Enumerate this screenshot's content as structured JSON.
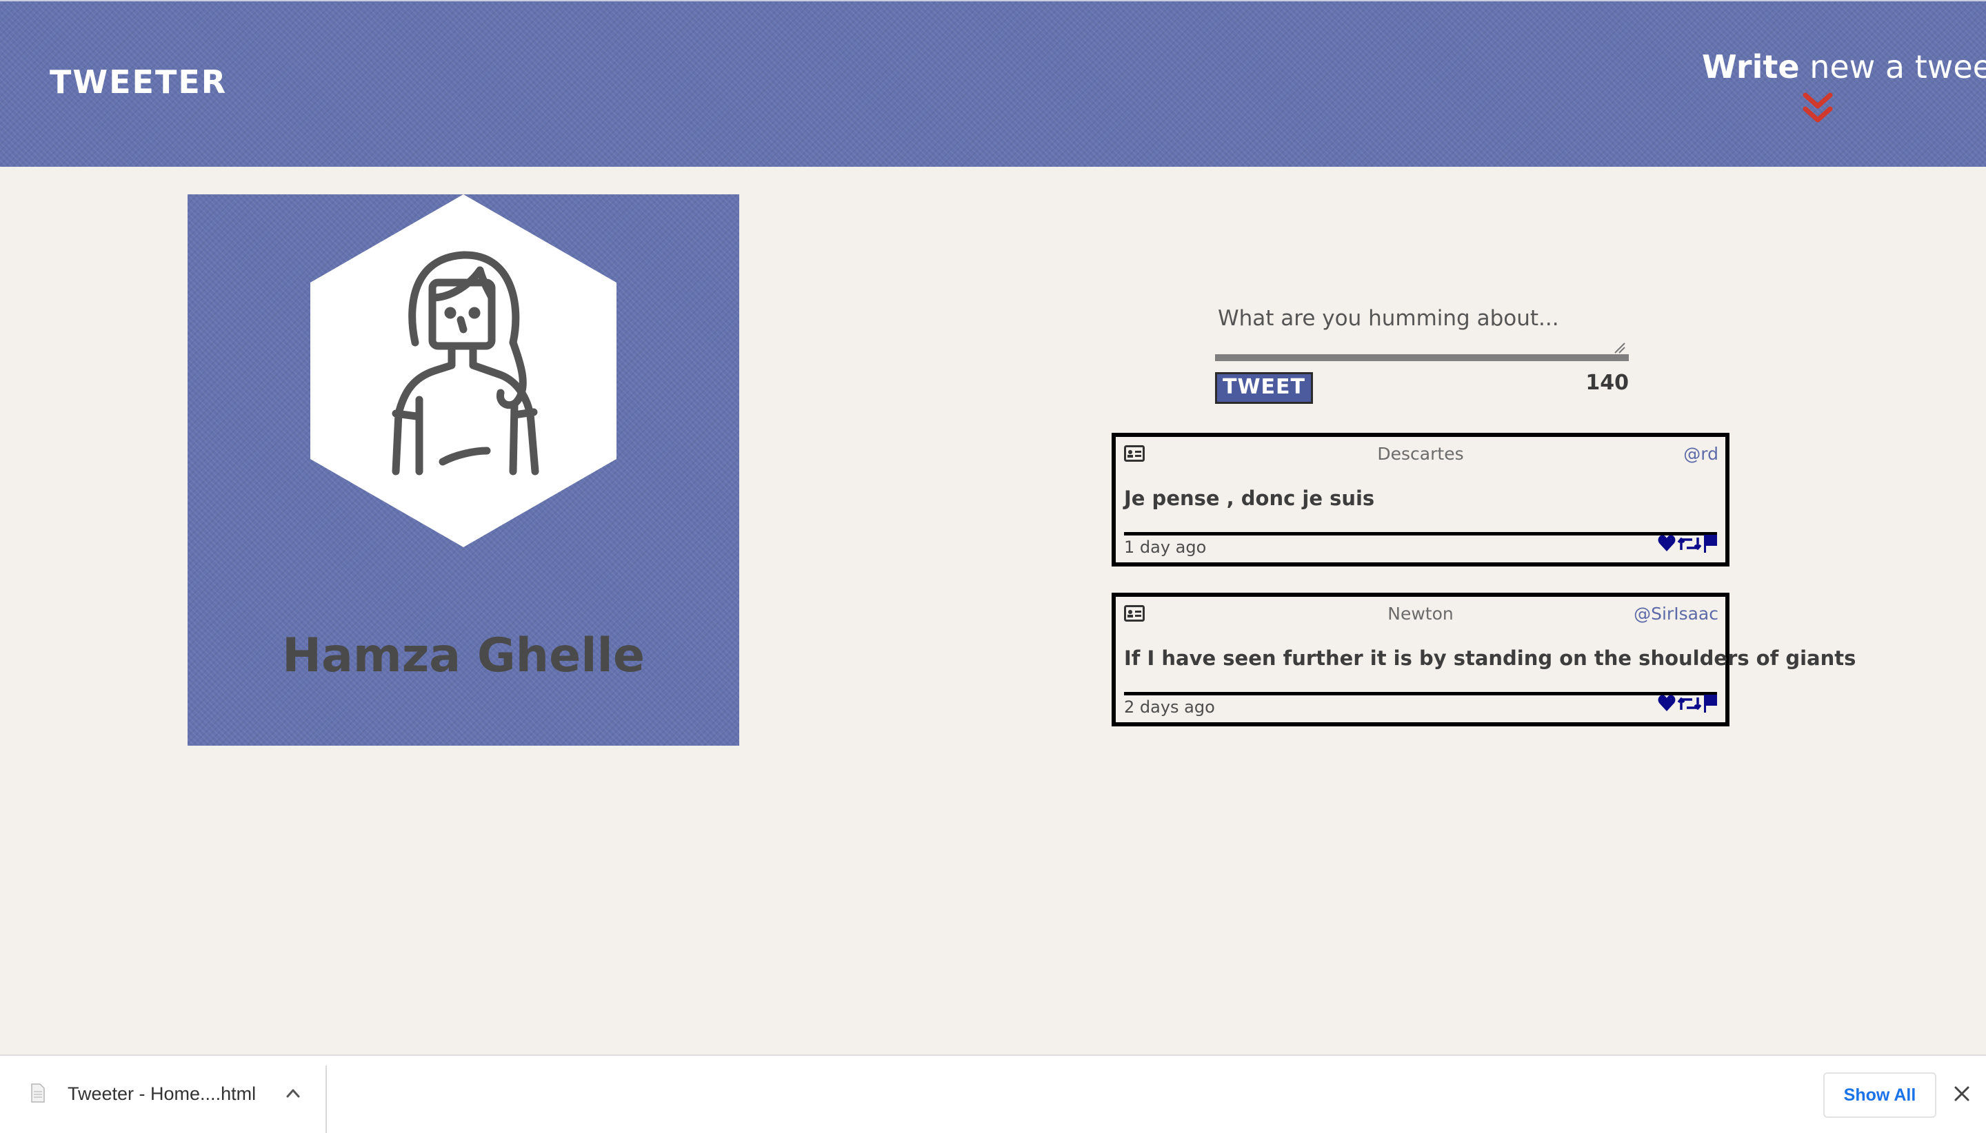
{
  "header": {
    "brand": "TWEETER",
    "compose_toggle": {
      "bold": "Write",
      "rest": " new a tweet",
      "icon": "double-chevron-down-icon"
    }
  },
  "profile": {
    "name": "Hamza Ghelle",
    "avatar_icon": "user-avatar-icon"
  },
  "composer": {
    "placeholder": "What are you humming about...",
    "value": "",
    "button_label": "TWEET",
    "char_count": "140"
  },
  "tweets": [
    {
      "author": "Descartes",
      "handle": "@rd",
      "text": "Je pense , donc je suis",
      "time": "1 day ago"
    },
    {
      "author": "Newton",
      "handle": "@SirIsaac",
      "text": "If I have seen further it is by standing on the shoulders of giants",
      "time": "2 days ago"
    }
  ],
  "downloads": {
    "filename": "Tweeter - Home....html",
    "show_all_label": "Show All"
  },
  "colors": {
    "banner": "#6472ae",
    "accent_red": "#d0392b",
    "action_blue": "#0a0a8a",
    "page_bg": "#f4f1ec"
  }
}
